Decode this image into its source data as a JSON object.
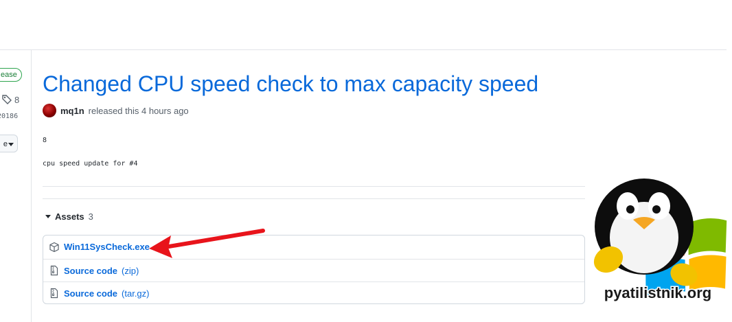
{
  "sidebar": {
    "label_badge": "ease",
    "tag_count": "8",
    "commit_sha": "20186",
    "compare_button_label": "e"
  },
  "release": {
    "title": "Changed CPU speed check to max capacity speed",
    "author": "mq1n",
    "released_text": "released this 4 hours ago",
    "body_line1": "8",
    "body_line2": "cpu speed update for #4"
  },
  "assets": {
    "title": "Assets",
    "count": "3",
    "items": [
      {
        "name": "Win11SysCheck.exe",
        "suffix": "",
        "icon": "package-icon"
      },
      {
        "name": "Source code",
        "suffix": "(zip)",
        "icon": "file-zip-icon"
      },
      {
        "name": "Source code",
        "suffix": "(tar.gz)",
        "icon": "file-zip-icon"
      }
    ]
  },
  "watermark": {
    "text": "pyatilistnik.org"
  },
  "colors": {
    "link": "#0969da",
    "arrow": "#e8141b",
    "badge_green": "#2da44e"
  }
}
